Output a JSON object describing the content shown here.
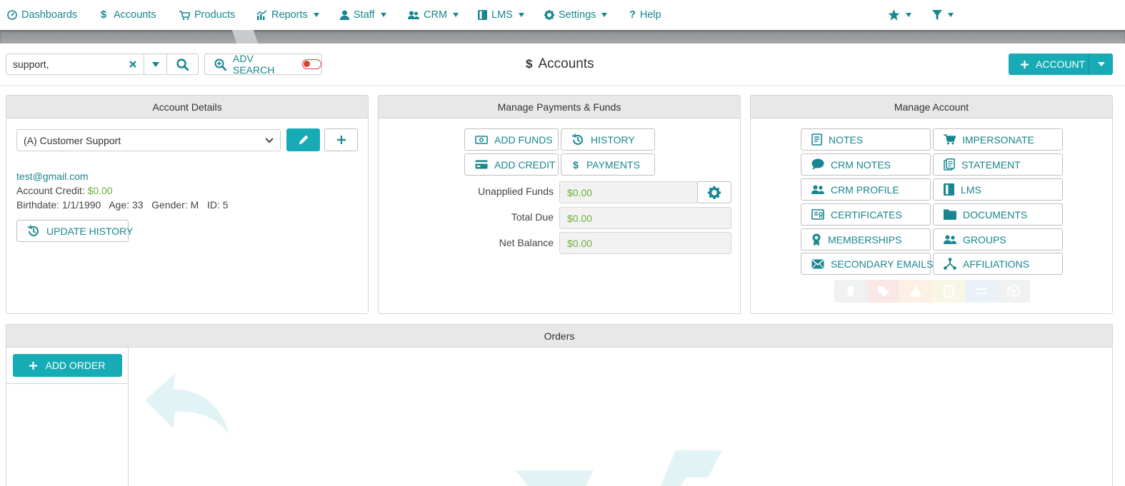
{
  "nav": {
    "dashboards": "Dashboards",
    "accounts": "Accounts",
    "products": "Products",
    "reports": "Reports",
    "staff": "Staff",
    "crm": "CRM",
    "lms": "LMS",
    "settings": "Settings",
    "help": "Help"
  },
  "search": {
    "value": "support,"
  },
  "adv_search": {
    "label": "ADV SEARCH",
    "enabled": false
  },
  "page": {
    "title": "Accounts"
  },
  "account_button": {
    "label": "ACCOUNT"
  },
  "account_details": {
    "header": "Account Details",
    "selected_account": "(A) Customer Support",
    "email": "test@gmail.com",
    "credit_label": "Account Credit:",
    "credit_value": "$0.00",
    "birthdate_line": "Birthdate: 1/1/1990   Age: 33   Gender: M   ID: 5",
    "update_history": "UPDATE HISTORY"
  },
  "payments": {
    "header": "Manage Payments & Funds",
    "add_funds": "ADD FUNDS",
    "history": "HISTORY",
    "add_credit": "ADD CREDIT",
    "payments": "PAYMENTS",
    "unapplied_label": "Unapplied Funds",
    "unapplied_value": "$0.00",
    "total_due_label": "Total Due",
    "total_due_value": "$0.00",
    "net_balance_label": "Net Balance",
    "net_balance_value": "$0.00"
  },
  "manage_account": {
    "header": "Manage Account",
    "notes": "NOTES",
    "impersonate": "IMPERSONATE",
    "crm_notes": "CRM NOTES",
    "statement": "STATEMENT",
    "crm_profile": "CRM PROFILE",
    "lms": "LMS",
    "certificates": "CERTIFICATES",
    "documents": "DOCUMENTS",
    "memberships": "MEMBERSHIPS",
    "groups": "GROUPS",
    "secondary_emails": "SECONDARY EMAILS",
    "affiliations": "AFFILIATIONS"
  },
  "orders": {
    "header": "Orders",
    "add_order": "ADD ORDER"
  },
  "colors": {
    "accent": "#17acb5",
    "link": "#17868f",
    "money": "#6aaf3b",
    "toggle_off": "#e53935"
  }
}
